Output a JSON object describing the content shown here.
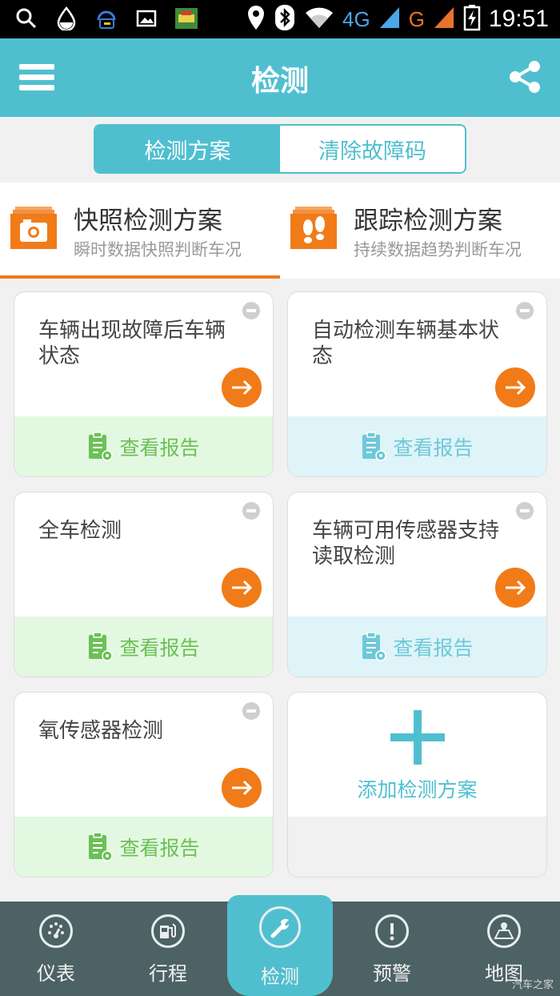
{
  "status_bar": {
    "network_4g": "4G",
    "network_g": "G",
    "time": "19:51"
  },
  "header": {
    "title": "检测"
  },
  "segment": {
    "tabs": [
      "检测方案",
      "清除故障码"
    ],
    "selected": "检测方案"
  },
  "plans": [
    {
      "title": "快照检测方案",
      "subtitle": "瞬时数据快照判断车况",
      "selected": true
    },
    {
      "title": "跟踪检测方案",
      "subtitle": "持续数据趋势判断车况",
      "selected": false
    }
  ],
  "cards": [
    {
      "title": "车辆出现故障后车辆状态",
      "report_label": "查看报告",
      "report_color": "green"
    },
    {
      "title": "自动检测车辆基本状态",
      "report_label": "查看报告",
      "report_color": "blue"
    },
    {
      "title": "全车检测",
      "report_label": "查看报告",
      "report_color": "green"
    },
    {
      "title": "车辆可用传感器支持读取检测",
      "report_label": "查看报告",
      "report_color": "blue"
    },
    {
      "title": "氧传感器检测",
      "report_label": "查看报告",
      "report_color": "green"
    }
  ],
  "add_card": {
    "label": "添加检测方案"
  },
  "bottom_nav": [
    {
      "label": "仪表",
      "icon": "gauge-icon"
    },
    {
      "label": "行程",
      "icon": "fuel-icon"
    },
    {
      "label": "检测",
      "icon": "wrench-icon",
      "active": true
    },
    {
      "label": "预警",
      "icon": "alert-icon"
    },
    {
      "label": "地图",
      "icon": "map-icon"
    }
  ],
  "watermark": "汽车之家",
  "colors": {
    "primary": "#4fbfd0",
    "accent": "#f07b18",
    "report_green_bg": "#e3f8e0",
    "report_blue_bg": "#def4f8",
    "nav_bg": "#4d6264"
  }
}
